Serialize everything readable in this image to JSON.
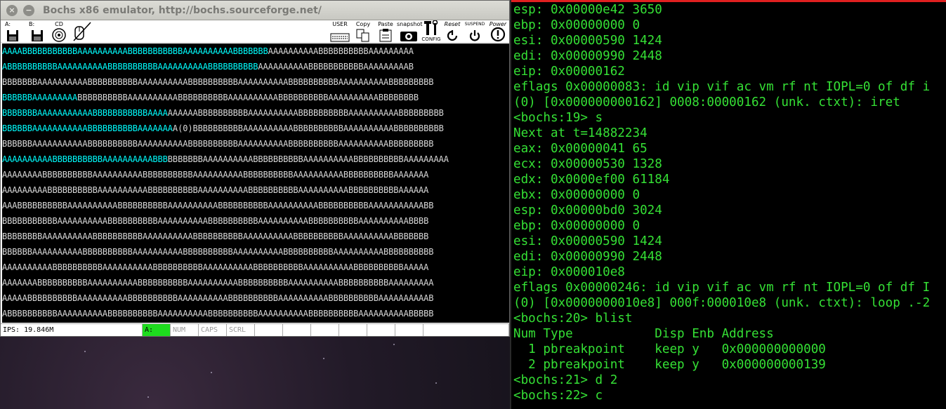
{
  "window": {
    "title": "Bochs x86 emulator, http://bochs.sourceforge.net/",
    "close_glyph": "×",
    "minimize_glyph": "−",
    "maximize_glyph": "□"
  },
  "toolbar": {
    "floppy_a_label": "A:",
    "floppy_b_label": "B:",
    "cdrom_label": "CD",
    "user_label": "USER",
    "copy_label": "Copy",
    "paste_label": "Paste",
    "snapshot_label": "snapshot",
    "config_label": "CONFIG",
    "reset_label": "Reset",
    "suspend_label": "SUSPEND",
    "power_label": "Power"
  },
  "screen": {
    "lines": [
      {
        "hl": "AAAABBBBBBBBBBBAAAAAAAAAABBBBBBBBBBBAAAAAAAAAABBBBBBB",
        "rest": "AAAAAAAAAABBBBBBBBBBAAAAAAAAA"
      },
      {
        "hl": "ABBBBBBBBBBAAAAAAAAAABBBBBBBBBBAAAAAAAAAABBBBBBBBBB",
        "rest": "AAAAAAAAAABBBBBBBBBBBAAAAAAAAAB"
      },
      {
        "hl": "",
        "rest": "BBBBBBBAAAAAAAAAABBBBBBBBBBAAAAAAAAAABBBBBBBBBBAAAAAAAAAABBBBBBBBBBAAAAAAAAAABBBBBBBBB"
      },
      {
        "hl": "BBBBBBAAAAAAAAA",
        "rest": "BBBBBBBBBBAAAAAAAAAABBBBBBBBBBAAAAAAAAAABBBBBBBBBBAAAAAAAAAABBBBBBBB"
      },
      {
        "hl": "BBBBBBBAAAAAAAAAAABBBBBBBBBBBAAAA",
        "rest": "AAAAAABBBBBBBBBBAAAAAAAAAABBBBBBBBBBAAAAAAAAAABBBBBBBBB"
      },
      {
        "hl": "BBBBBBAAAAAAAAAAABBBBBBBBBBAAAAAAA",
        "rest": "A(0)BBBBBBBBBBAAAAAAAAAABBBBBBBBBBAAAAAAAAAABBBBBBBBBB"
      },
      {
        "hl": "",
        "rest": "BBBBBBAAAAAAAAAAABBBBBBBBBBAAAAAAAAAABBBBBBBBBBAAAAAAAAAABBBBBBBBBBAAAAAAAAAABBBBBBBBB"
      },
      {
        "hl": "AAAAAAAAAABBBBBBBBBBAAAAAAAAAABBB",
        "rest": "BBBBBBBAAAAAAAAAABBBBBBBBBBAAAAAAAAAABBBBBBBBBBAAAAAAAAA"
      },
      {
        "hl": "",
        "rest": "AAAAAAAABBBBBBBBBBAAAAAAAAAABBBBBBBBBBAAAAAAAAAABBBBBBBBBBAAAAAAAAAABBBBBBBBBBAAAAAAA"
      },
      {
        "hl": "",
        "rest": "AAAAAAAAABBBBBBBBBBAAAAAAAAAABBBBBBBBBBAAAAAAAAAABBBBBBBBBBAAAAAAAAAABBBBBBBBBBAAAAAA"
      },
      {
        "hl": "",
        "rest": "AAABBBBBBBBBBAAAAAAAAAABBBBBBBBBBAAAAAAAAAABBBBBBBBBBAAAAAAAAAABBBBBBBBBBAAAAAAAAAAABB"
      },
      {
        "hl": "",
        "rest": "BBBBBBBBBBBAAAAAAAAAABBBBBBBBBBAAAAAAAAAABBBBBBBBBBAAAAAAAAAABBBBBBBBBBAAAAAAAAAABBBB"
      },
      {
        "hl": "",
        "rest": "BBBBBBBBAAAAAAAAAABBBBBBBBBBAAAAAAAAAABBBBBBBBBBAAAAAAAAAABBBBBBBBBBAAAAAAAAAABBBBBBB"
      },
      {
        "hl": "",
        "rest": "BBBBBBAAAAAAAAAABBBBBBBBBBAAAAAAAAAABBBBBBBBBBAAAAAAAAAABBBBBBBBBBAAAAAAAAAABBBBBBBBBB"
      },
      {
        "hl": "",
        "rest": "AAAAAAAAAABBBBBBBBBBAAAAAAAAAABBBBBBBBBBAAAAAAAAAABBBBBBBBBBAAAAAAAAAABBBBBBBBBBAAAAA"
      },
      {
        "hl": "",
        "rest": "AAAAAAABBBBBBBBBBAAAAAAAAAABBBBBBBBBBAAAAAAAAAABBBBBBBBBBAAAAAAAAAABBBBBBBBBBAAAAAAAAA"
      },
      {
        "hl": "",
        "rest": "AAAAABBBBBBBBBBAAAAAAAAAABBBBBBBBBBAAAAAAAAAABBBBBBBBBBAAAAAAAAAABBBBBBBBBBAAAAAAAAAAB"
      },
      {
        "hl": "",
        "rest": "ABBBBBBBBBBAAAAAAAAAABBBBBBBBBBAAAAAAAAAABBBBBBBBBBAAAAAAAAAABBBBBBBBBBAAAAAAAAAABBBBB"
      },
      {
        "hl": "",
        "rest": "BBBBBBBBBBAAAAAAAAAABBBBBBBBBBAAAAAAAAAABBBBBBBBBBAAAAAAAAAABBBBBBBBBBAAAAAAAAAABBBBBB"
      },
      {
        "hl": "",
        "rest": "BBBBBBBAAAAAAAAAABBBBBBBBBBAAAAAAAAAABBBBBBBBBBAAAAAAAAAABBBBBBBBBBAAAAAAAAAABBBBBBBBB"
      },
      {
        "hl": "",
        "rest": "BBBBAAAAAAAAAABBBBBBBBBBAAAAAAAAAABBBBBBBBBBAAAAAAAAAABBBBBBBBBBAAAAAAAAAABBBBBBBBBBAA"
      },
      {
        "hl": "",
        "rest": "AAAAAAAAABBBBBBBBBBAAAAAAAAAABBBBBBBBBBAAAAAAAAAABBBBBBBBBBAAAAAAAAAABBBBBBBBBBAAAAAA"
      },
      {
        "hl": "",
        "rest": "AAAAAAAAAABBBBBBBBBBBAAAAAAAAAABBBBBBBBBBAAAAAAAAAABBBBBBBBBBAAAAAAAAAABBBBBBBBBBAAAA"
      }
    ]
  },
  "status": {
    "ips": "IPS: 19.846M",
    "floppy": "A:",
    "num": "NUM",
    "caps": "CAPS",
    "scrl": "SCRL"
  },
  "terminal": {
    "lines": [
      "esp: 0x00000e42 3650",
      "ebp: 0x00000000 0",
      "esi: 0x00000590 1424",
      "edi: 0x00000990 2448",
      "eip: 0x00000162",
      "eflags 0x00000083: id vip vif ac vm rf nt IOPL=0 of df i",
      "(0) [0x000000000162] 0008:00000162 (unk. ctxt): iret",
      "<bochs:19> s",
      "Next at t=14882234",
      "eax: 0x00000041 65",
      "ecx: 0x00000530 1328",
      "edx: 0x0000ef00 61184",
      "ebx: 0x00000000 0",
      "esp: 0x00000bd0 3024",
      "ebp: 0x00000000 0",
      "esi: 0x00000590 1424",
      "edi: 0x00000990 2448",
      "eip: 0x000010e8",
      "eflags 0x00000246: id vip vif ac vm rf nt IOPL=0 of df I",
      "(0) [0x0000000010e8] 000f:000010e8 (unk. ctxt): loop .-2",
      "<bochs:20> blist",
      "Num Type           Disp Enb Address",
      "  1 pbreakpoint    keep y   0x000000000000",
      "  2 pbreakpoint    keep y   0x000000000139",
      "<bochs:21> d 2",
      "<bochs:22> c"
    ]
  },
  "colors": {
    "terminal_text": "#35e035",
    "screen_text": "#d9d9d9",
    "screen_highlight": "#00ffff",
    "floppy_led": "#1edc1e",
    "terminal_top_border": "#e02020"
  }
}
